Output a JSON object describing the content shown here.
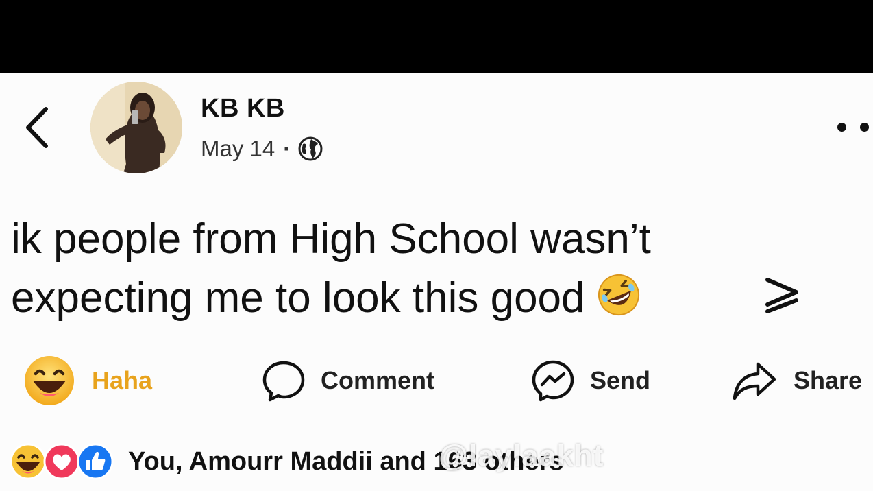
{
  "post": {
    "author": "KB KB",
    "date": "May 14",
    "privacy_separator": "·",
    "privacy_icon": "globe-icon",
    "text_lines": [
      "ik people from High School wasn’t",
      "expecting me to look this good"
    ],
    "inline_emoji": "rolling-on-floor-laughing-emoji"
  },
  "actions": {
    "haha": "Haha",
    "comment": "Comment",
    "send": "Send",
    "share": "Share"
  },
  "reactions": {
    "icons": [
      "haha-icon",
      "love-icon",
      "like-icon"
    ],
    "summary": "You, Amourr Maddii and 163 others"
  },
  "watermark": "@laylaakht",
  "colors": {
    "haha_label": "#e8a31d",
    "like_blue": "#1877f2",
    "love_red": "#f0395b",
    "haha_yellow": "#f7c235"
  }
}
